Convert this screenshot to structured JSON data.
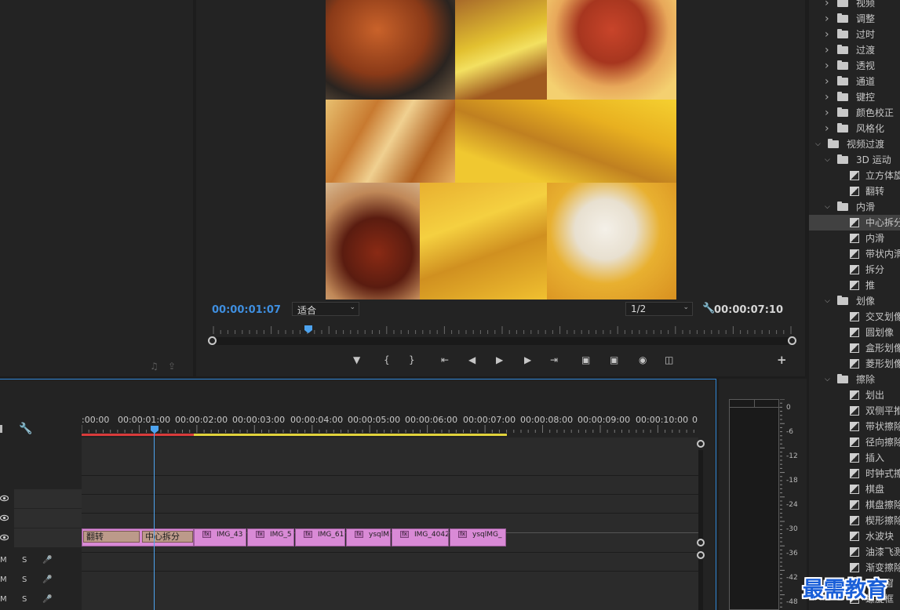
{
  "program": {
    "timecode": "00:00:01:07",
    "zoom": "适合",
    "resolution": "1/2",
    "duration": "00:00:07:10"
  },
  "timeline": {
    "ruler_labels": [
      ":00:00",
      "00:00:01:00",
      "00:00:02:00",
      "00:00:03:00",
      "00:00:04:00",
      "00:00:05:00",
      "00:00:06:00",
      "00:00:07:00",
      "00:00:08:00",
      "00:00:09:00",
      "00:00:10:00",
      "0"
    ],
    "clips": [
      "IMG_43",
      "IMG_5",
      "IMG_61",
      "ysqlM",
      "IMG_4042",
      "ysqlMG_"
    ],
    "transitions": [
      "翻转",
      "中心拆分"
    ],
    "audio_m": "M",
    "audio_s": "S",
    "fx_badge": "fx"
  },
  "meter": {
    "db_labels": [
      "0",
      "-6",
      "-12",
      "-18",
      "-24",
      "-30",
      "-36",
      "-42",
      "-48"
    ]
  },
  "effects": {
    "items": [
      {
        "label": "视频",
        "type": "folder",
        "level": 1,
        "open": false
      },
      {
        "label": "调整",
        "type": "folder",
        "level": 1,
        "open": false
      },
      {
        "label": "过时",
        "type": "folder",
        "level": 1,
        "open": false
      },
      {
        "label": "过渡",
        "type": "folder",
        "level": 1,
        "open": false
      },
      {
        "label": "透视",
        "type": "folder",
        "level": 1,
        "open": false
      },
      {
        "label": "通道",
        "type": "folder",
        "level": 1,
        "open": false
      },
      {
        "label": "键控",
        "type": "folder",
        "level": 1,
        "open": false
      },
      {
        "label": "颜色校正",
        "type": "folder",
        "level": 1,
        "open": false
      },
      {
        "label": "风格化",
        "type": "folder",
        "level": 1,
        "open": false
      },
      {
        "label": "视频过渡",
        "type": "folder",
        "level": 0,
        "open": true
      },
      {
        "label": "3D 运动",
        "type": "folder",
        "level": 1,
        "open": true
      },
      {
        "label": "立方体旋转",
        "type": "item",
        "level": 2
      },
      {
        "label": "翻转",
        "type": "item",
        "level": 2
      },
      {
        "label": "内滑",
        "type": "folder",
        "level": 1,
        "open": true
      },
      {
        "label": "中心拆分",
        "type": "item",
        "level": 2,
        "selected": true
      },
      {
        "label": "内滑",
        "type": "item",
        "level": 2
      },
      {
        "label": "带状内滑",
        "type": "item",
        "level": 2
      },
      {
        "label": "拆分",
        "type": "item",
        "level": 2
      },
      {
        "label": "推",
        "type": "item",
        "level": 2
      },
      {
        "label": "划像",
        "type": "folder",
        "level": 1,
        "open": true
      },
      {
        "label": "交叉划像",
        "type": "item",
        "level": 2
      },
      {
        "label": "圆划像",
        "type": "item",
        "level": 2
      },
      {
        "label": "盒形划像",
        "type": "item",
        "level": 2
      },
      {
        "label": "菱形划像",
        "type": "item",
        "level": 2
      },
      {
        "label": "擦除",
        "type": "folder",
        "level": 1,
        "open": true
      },
      {
        "label": "划出",
        "type": "item",
        "level": 2
      },
      {
        "label": "双侧平推门",
        "type": "item",
        "level": 2
      },
      {
        "label": "带状擦除",
        "type": "item",
        "level": 2
      },
      {
        "label": "径向擦除",
        "type": "item",
        "level": 2
      },
      {
        "label": "插入",
        "type": "item",
        "level": 2
      },
      {
        "label": "时钟式擦除",
        "type": "item",
        "level": 2
      },
      {
        "label": "棋盘",
        "type": "item",
        "level": 2
      },
      {
        "label": "棋盘擦除",
        "type": "item",
        "level": 2
      },
      {
        "label": "楔形擦除",
        "type": "item",
        "level": 2
      },
      {
        "label": "水波块",
        "type": "item",
        "level": 2
      },
      {
        "label": "油漆飞溅",
        "type": "item",
        "level": 2
      },
      {
        "label": "渐变擦除",
        "type": "item",
        "level": 2
      },
      {
        "label": "百叶窗",
        "type": "item",
        "level": 2
      },
      {
        "label": "螺旋框",
        "type": "item",
        "level": 2
      }
    ]
  },
  "watermark": "最需教育",
  "colors": {
    "accent_blue": "#3f8fe0",
    "clip_pink": "#d98ad6",
    "work_red": "#d93b3b",
    "work_yellow": "#e0d23b"
  }
}
